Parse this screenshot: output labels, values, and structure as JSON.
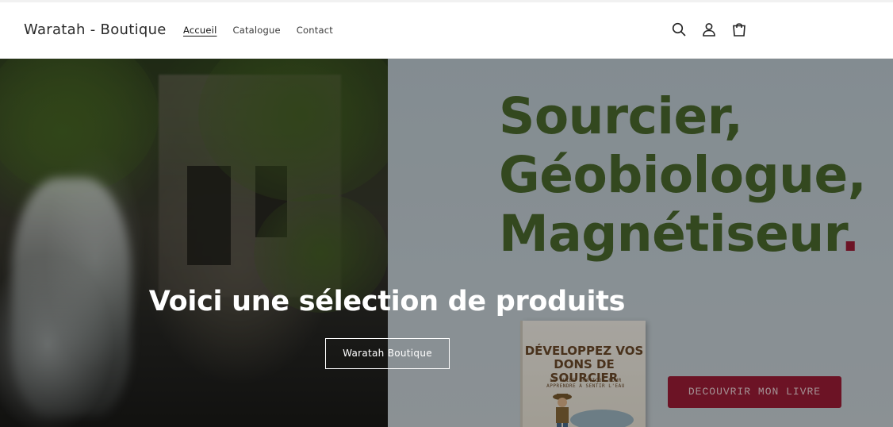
{
  "header": {
    "brand": "Waratah - Boutique",
    "nav": [
      {
        "label": "Accueil",
        "active": true
      },
      {
        "label": "Catalogue",
        "active": false
      },
      {
        "label": "Contact",
        "active": false
      }
    ],
    "icons": [
      "search-icon",
      "account-icon",
      "cart-icon"
    ]
  },
  "hero": {
    "heading": "Voici une sélection de produits",
    "button_label": "Waratah Boutique",
    "promo": {
      "title_lines": [
        "Sourcier,",
        "Géobiologue,",
        "Magnétiseur"
      ],
      "title_dot": ".",
      "book_title": "DÉVELOPPEZ VOS DONS DE SOURCIER",
      "book_subtitle": "LE GUIDE PRATIQUE POUR APPRENDRE À SENTIR L'EAU",
      "cta_label": "DECOUVRIR MON LIVRE",
      "colors": {
        "title": "#4c6a2f",
        "accent": "#a01d37"
      }
    }
  }
}
